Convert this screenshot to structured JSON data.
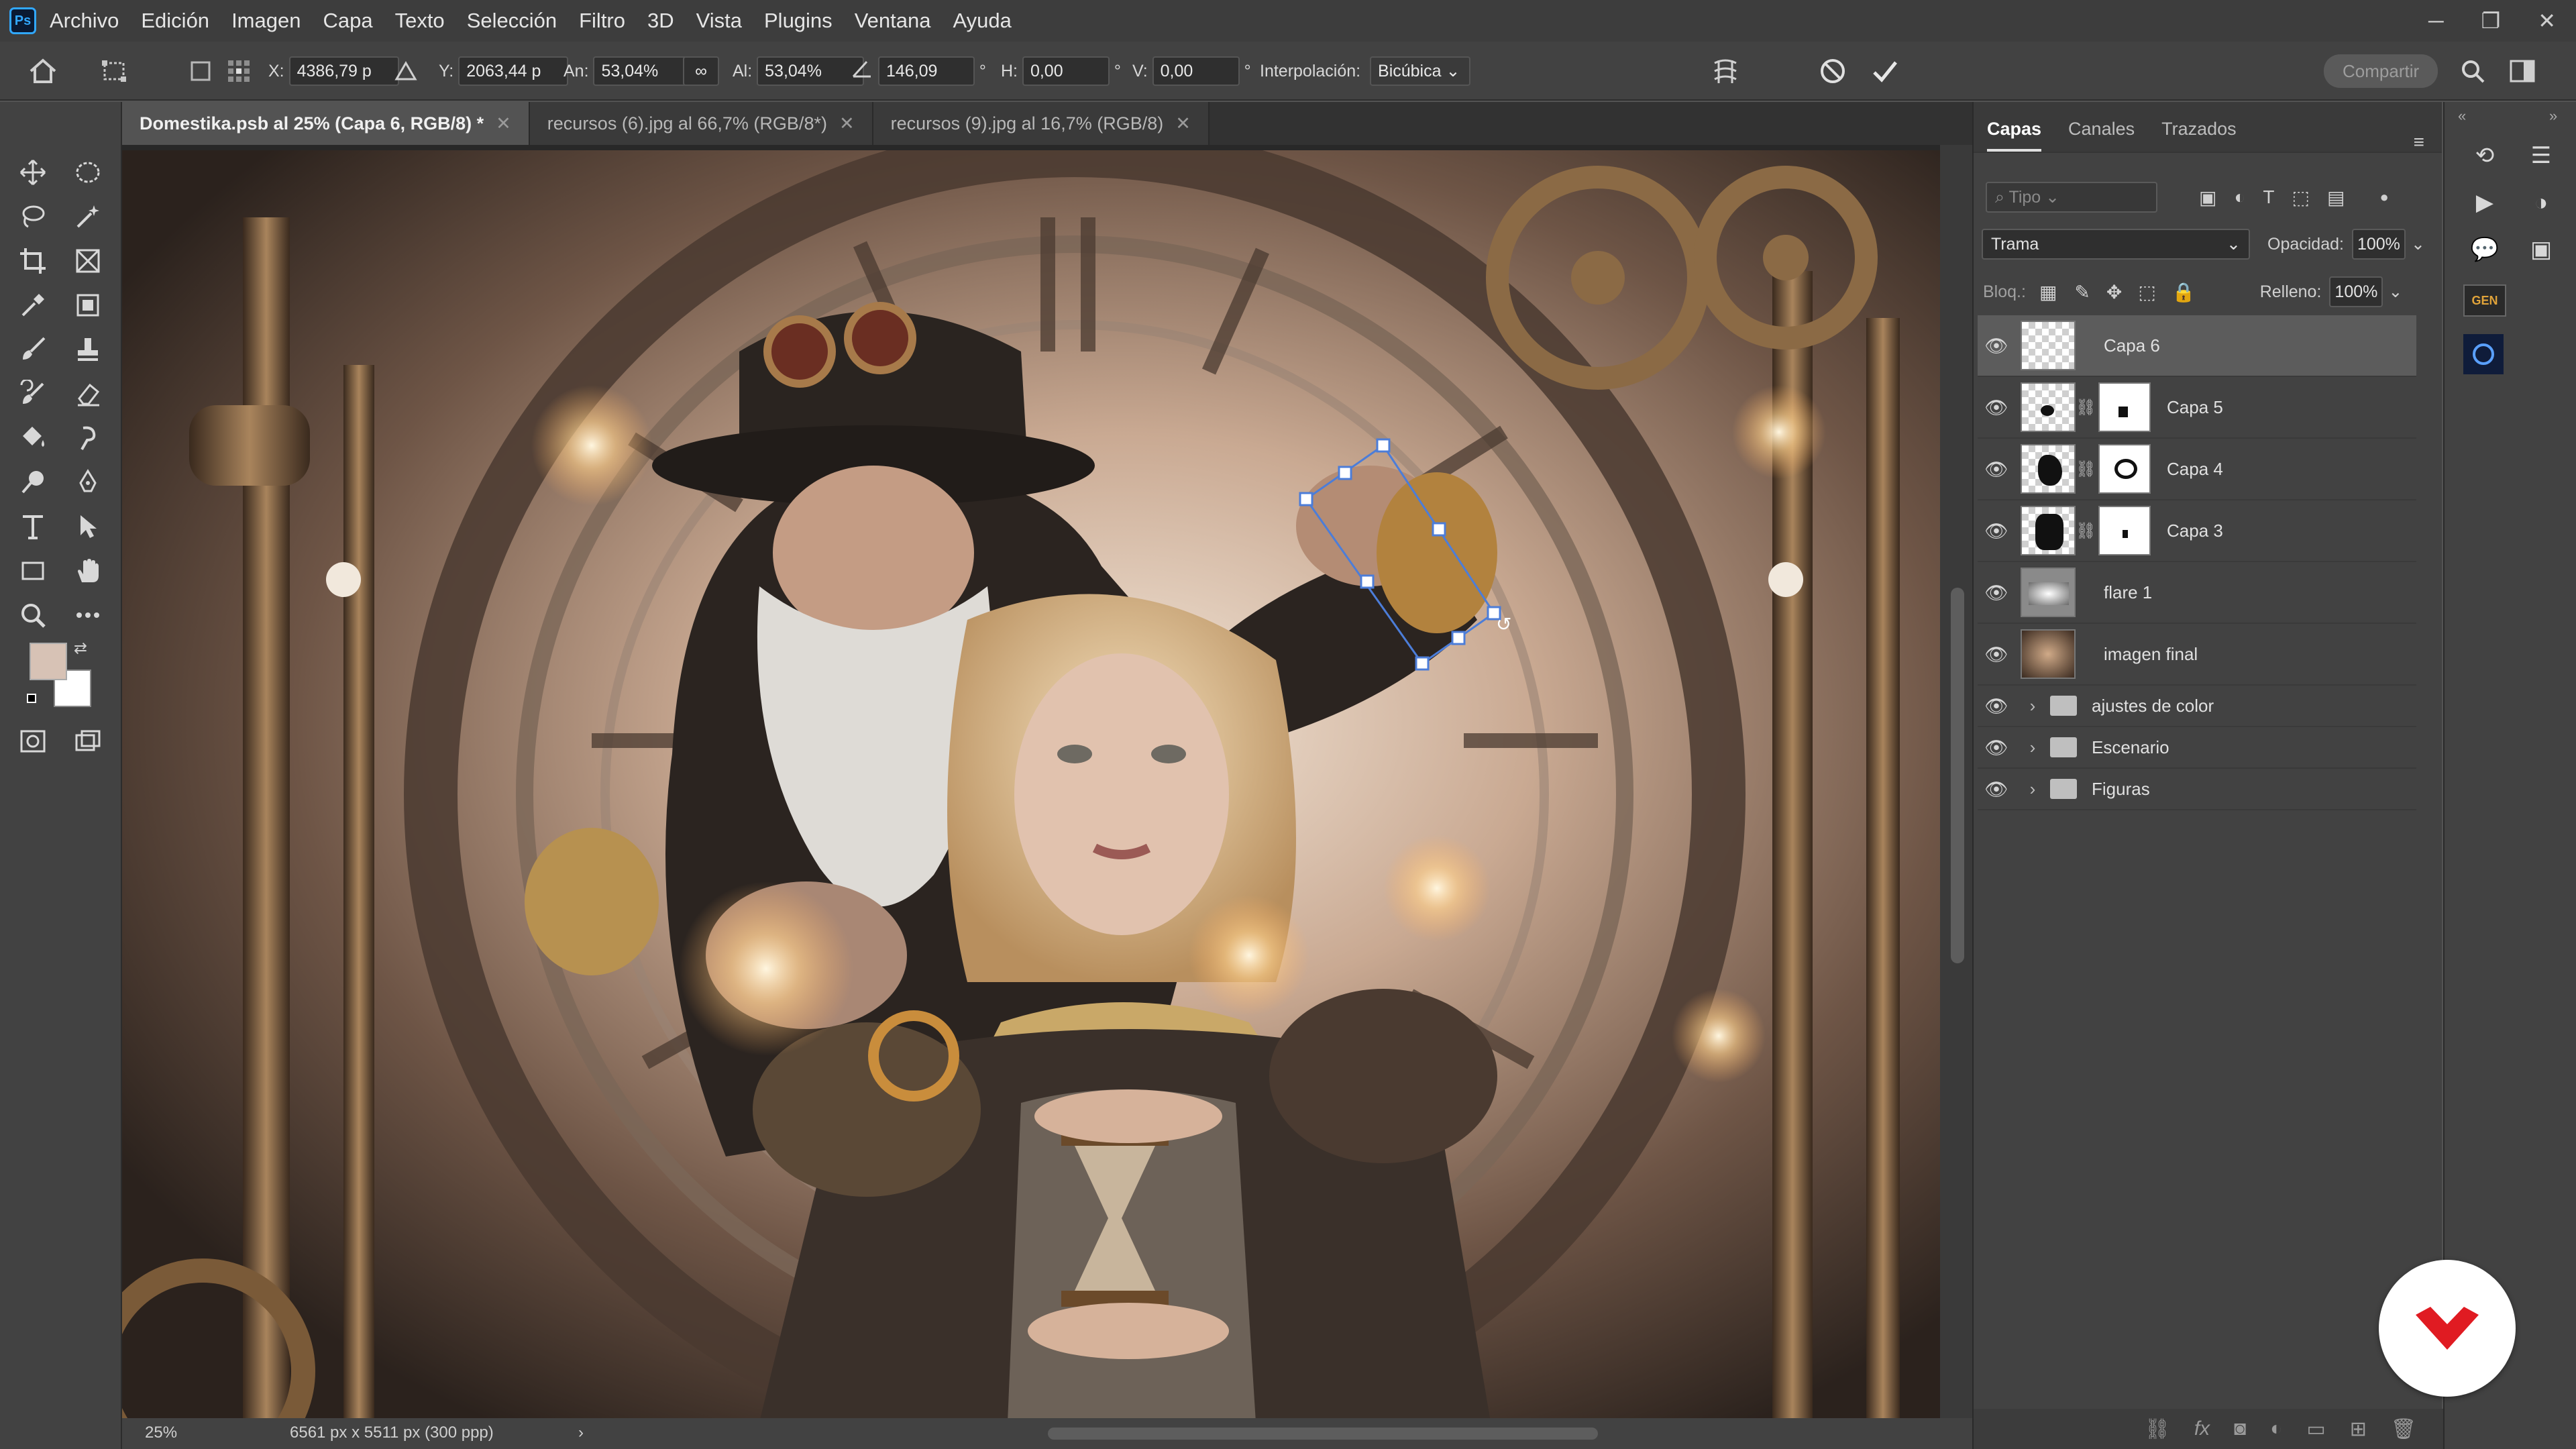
{
  "app": {
    "logo": "Ps"
  },
  "menu": [
    "Archivo",
    "Edición",
    "Imagen",
    "Capa",
    "Texto",
    "Selección",
    "Filtro",
    "3D",
    "Vista",
    "Plugins",
    "Ventana",
    "Ayuda"
  ],
  "window_controls": {
    "minimize": "─",
    "restore": "❐",
    "close": "✕"
  },
  "options": {
    "x_label": "X:",
    "x_value": "4386,79 p",
    "y_label": "Y:",
    "y_value": "2063,44 p",
    "w_label": "An:",
    "w_value": "53,04%",
    "h_label": "Al:",
    "h_value": "53,04%",
    "angle_value": "146,09",
    "deg": "°",
    "hskew_label": "H:",
    "hskew_value": "0,00",
    "vskew_label": "V:",
    "vskew_value": "0,00",
    "interp_label": "Interpolación:",
    "interp_value": "Bicúbica",
    "share": "Compartir"
  },
  "tabs": [
    {
      "label": "Domestika.psb al 25% (Capa 6, RGB/8) *"
    },
    {
      "label": "recursos (6).jpg al 66,7% (RGB/8*)"
    },
    {
      "label": "recursos (9).jpg al 16,7% (RGB/8)"
    }
  ],
  "status": {
    "zoom": "25%",
    "doc_size": "6561 px x 5511 px (300 ppp)",
    "arrow": "›"
  },
  "panel": {
    "tabs": [
      "Capas",
      "Canales",
      "Trazados"
    ],
    "search_placeholder": "Tipo",
    "blend_mode": "Trama",
    "opacity_label": "Opacidad:",
    "opacity_value": "100%",
    "lock_label": "Bloq.:",
    "fill_label": "Relleno:",
    "fill_value": "100%",
    "layers": [
      {
        "name": "Capa 6"
      },
      {
        "name": "Capa 5"
      },
      {
        "name": "Capa 4"
      },
      {
        "name": "Capa 3"
      },
      {
        "name": "flare 1"
      },
      {
        "name": "imagen final"
      },
      {
        "name": "ajustes de color"
      },
      {
        "name": "Escenario"
      },
      {
        "name": "Figuras"
      }
    ]
  },
  "side": {
    "gen_badge": "GEN"
  },
  "colors": {
    "accent": "#31a8ff",
    "brand_red": "#e01b22",
    "panel_bg": "#424242",
    "foreground": "#d7c2b5",
    "background": "#ffffff"
  }
}
